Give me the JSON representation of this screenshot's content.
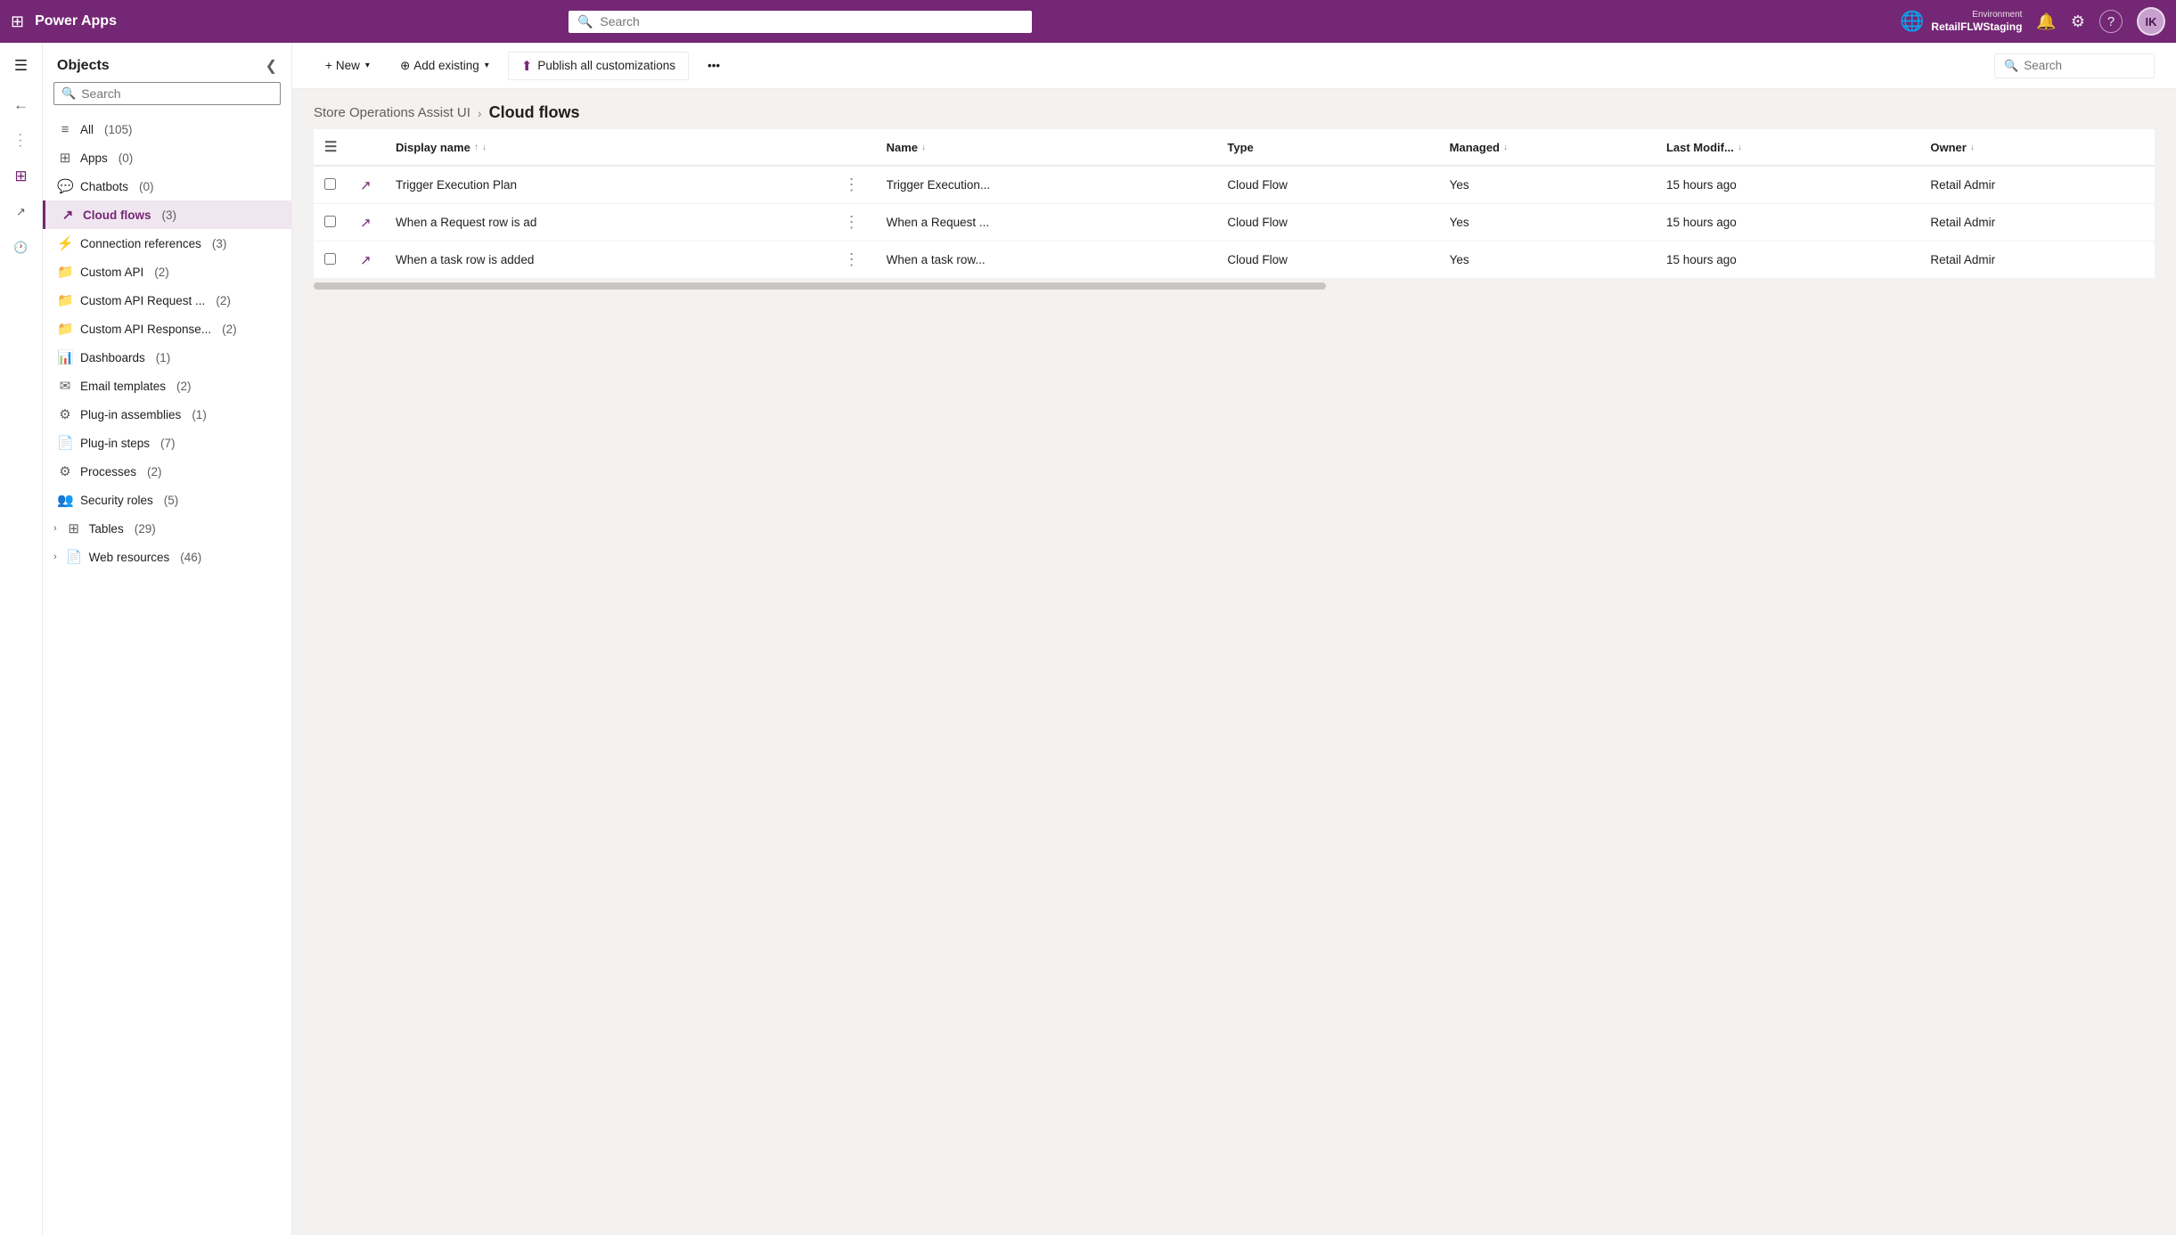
{
  "app": {
    "title": "Power Apps",
    "waffle_icon": "⊞",
    "search_placeholder": "Search",
    "search_value": ""
  },
  "topnav": {
    "env_label": "Environment",
    "env_name": "RetailFLWStaging",
    "env_icon": "🌐",
    "bell_icon": "🔔",
    "gear_icon": "⚙",
    "help_icon": "?",
    "avatar_initials": "IK"
  },
  "sidebar": {
    "title": "Objects",
    "search_placeholder": "Search",
    "items": [
      {
        "label": "All",
        "count": "(105)",
        "icon": "≡",
        "active": false
      },
      {
        "label": "Apps",
        "count": "(0)",
        "icon": "⊞",
        "active": false
      },
      {
        "label": "Chatbots",
        "count": "(0)",
        "icon": "💬",
        "active": false
      },
      {
        "label": "Cloud flows",
        "count": "(3)",
        "icon": "↗",
        "active": true
      },
      {
        "label": "Connection references",
        "count": "(3)",
        "icon": "⚡",
        "active": false
      },
      {
        "label": "Custom API",
        "count": "(2)",
        "icon": "📁",
        "active": false
      },
      {
        "label": "Custom API Request ...",
        "count": "(2)",
        "icon": "📁",
        "active": false
      },
      {
        "label": "Custom API Response...",
        "count": "(2)",
        "icon": "📁",
        "active": false
      },
      {
        "label": "Dashboards",
        "count": "(1)",
        "icon": "📊",
        "active": false
      },
      {
        "label": "Email templates",
        "count": "(2)",
        "icon": "✉",
        "active": false
      },
      {
        "label": "Plug-in assemblies",
        "count": "(1)",
        "icon": "⚙",
        "active": false
      },
      {
        "label": "Plug-in steps",
        "count": "(7)",
        "icon": "📄",
        "active": false
      },
      {
        "label": "Processes",
        "count": "(2)",
        "icon": "⚙",
        "active": false
      },
      {
        "label": "Security roles",
        "count": "(5)",
        "icon": "👥",
        "active": false
      },
      {
        "label": "Tables",
        "count": "(29)",
        "icon": "⊞",
        "active": false,
        "expandable": true
      },
      {
        "label": "Web resources",
        "count": "(46)",
        "icon": "📄",
        "active": false,
        "expandable": true
      }
    ]
  },
  "toolbar": {
    "new_label": "New",
    "new_icon": "+",
    "add_existing_label": "Add existing",
    "add_existing_icon": "⊕",
    "publish_label": "Publish all customizations",
    "publish_icon": "⬆",
    "more_icon": "•••",
    "search_placeholder": "Search",
    "search_icon": "🔍"
  },
  "breadcrumb": {
    "parent": "Store Operations Assist UI",
    "separator": "›",
    "current": "Cloud flows"
  },
  "table": {
    "columns": [
      {
        "label": "Display name",
        "key": "display_name",
        "sortable": true,
        "sort_dir": "asc"
      },
      {
        "label": "Name",
        "key": "name",
        "sortable": true
      },
      {
        "label": "Type",
        "key": "type",
        "sortable": false
      },
      {
        "label": "Managed",
        "key": "managed",
        "sortable": true
      },
      {
        "label": "Last Modif...",
        "key": "last_modified",
        "sortable": true
      },
      {
        "label": "Owner",
        "key": "owner",
        "sortable": true
      }
    ],
    "rows": [
      {
        "icon": "↗",
        "display_name": "Trigger Execution Plan",
        "name": "Trigger Execution...",
        "type": "Cloud Flow",
        "managed": "Yes",
        "last_modified": "15 hours ago",
        "owner": "Retail Admir"
      },
      {
        "icon": "↗",
        "display_name": "When a Request row is ad",
        "name": "When a Request ...",
        "type": "Cloud Flow",
        "managed": "Yes",
        "last_modified": "15 hours ago",
        "owner": "Retail Admir"
      },
      {
        "icon": "↗",
        "display_name": "When a task row is added",
        "name": "When a task row...",
        "type": "Cloud Flow",
        "managed": "Yes",
        "last_modified": "15 hours ago",
        "owner": "Retail Admir"
      }
    ]
  },
  "rail_icons": [
    {
      "name": "menu-icon",
      "symbol": "☰"
    },
    {
      "name": "back-icon",
      "symbol": "←"
    },
    {
      "name": "ellipsis-icon",
      "symbol": "•••"
    },
    {
      "name": "table-icon",
      "symbol": "⊞"
    },
    {
      "name": "flows-icon",
      "symbol": "↗"
    },
    {
      "name": "history-icon",
      "symbol": "🕐"
    }
  ]
}
